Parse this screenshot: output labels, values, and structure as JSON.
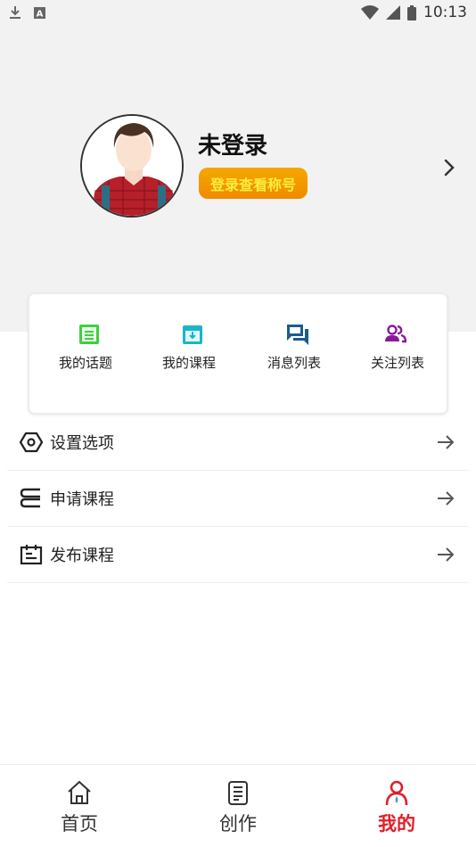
{
  "status_bar": {
    "time": "10:13"
  },
  "profile": {
    "username": "未登录",
    "login_badge": "登录查看称号"
  },
  "quick_actions": [
    {
      "label": "我的话题",
      "icon": "topic-icon",
      "color": "#3fcf3f"
    },
    {
      "label": "我的课程",
      "icon": "course-download-icon",
      "color": "#18b6c8"
    },
    {
      "label": "消息列表",
      "icon": "message-list-icon",
      "color": "#1c5b8e"
    },
    {
      "label": "关注列表",
      "icon": "follow-list-icon",
      "color": "#8a1a9a"
    }
  ],
  "menu": [
    {
      "label": "设置选项",
      "icon": "settings-icon"
    },
    {
      "label": "申请课程",
      "icon": "apply-course-icon"
    },
    {
      "label": "发布课程",
      "icon": "publish-course-icon"
    }
  ],
  "tabs": [
    {
      "label": "首页",
      "icon": "home-icon",
      "active": false
    },
    {
      "label": "创作",
      "icon": "create-icon",
      "active": false
    },
    {
      "label": "我的",
      "icon": "profile-icon",
      "active": true
    }
  ],
  "colors": {
    "accent": "#e0202a",
    "badge": "#f29400",
    "badge_text": "#ffef3a",
    "header_bg": "#f2f2f2"
  }
}
